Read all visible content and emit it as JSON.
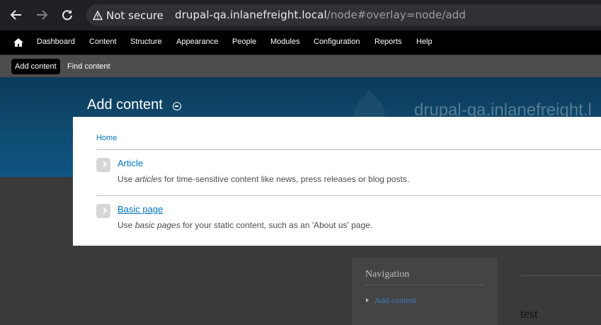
{
  "browser": {
    "security_label": "Not secure",
    "url_host": "drupal-qa.inlanefreight.local",
    "url_path": "/node#overlay=node/add"
  },
  "toolbar": {
    "items": [
      "Dashboard",
      "Content",
      "Structure",
      "Appearance",
      "People",
      "Modules",
      "Configuration",
      "Reports",
      "Help"
    ]
  },
  "shortcuts": {
    "items": [
      "Add content",
      "Find content"
    ]
  },
  "overlay": {
    "title": "Add content",
    "site_name": "drupal-qa.inlanefreight.l"
  },
  "panel": {
    "breadcrumb": "Home",
    "types": [
      {
        "title": "Article",
        "desc_before": "Use ",
        "desc_em": "articles",
        "desc_after": " for time-sensitive content like news, press releases or blog posts."
      },
      {
        "title": "Basic page",
        "desc_before": "Use ",
        "desc_em": "basic pages",
        "desc_after": " for your static content, such as an 'About us' page."
      }
    ]
  },
  "background_page": {
    "nav_heading": "Navigation",
    "nav_link": "Add content",
    "node_title": "test"
  }
}
